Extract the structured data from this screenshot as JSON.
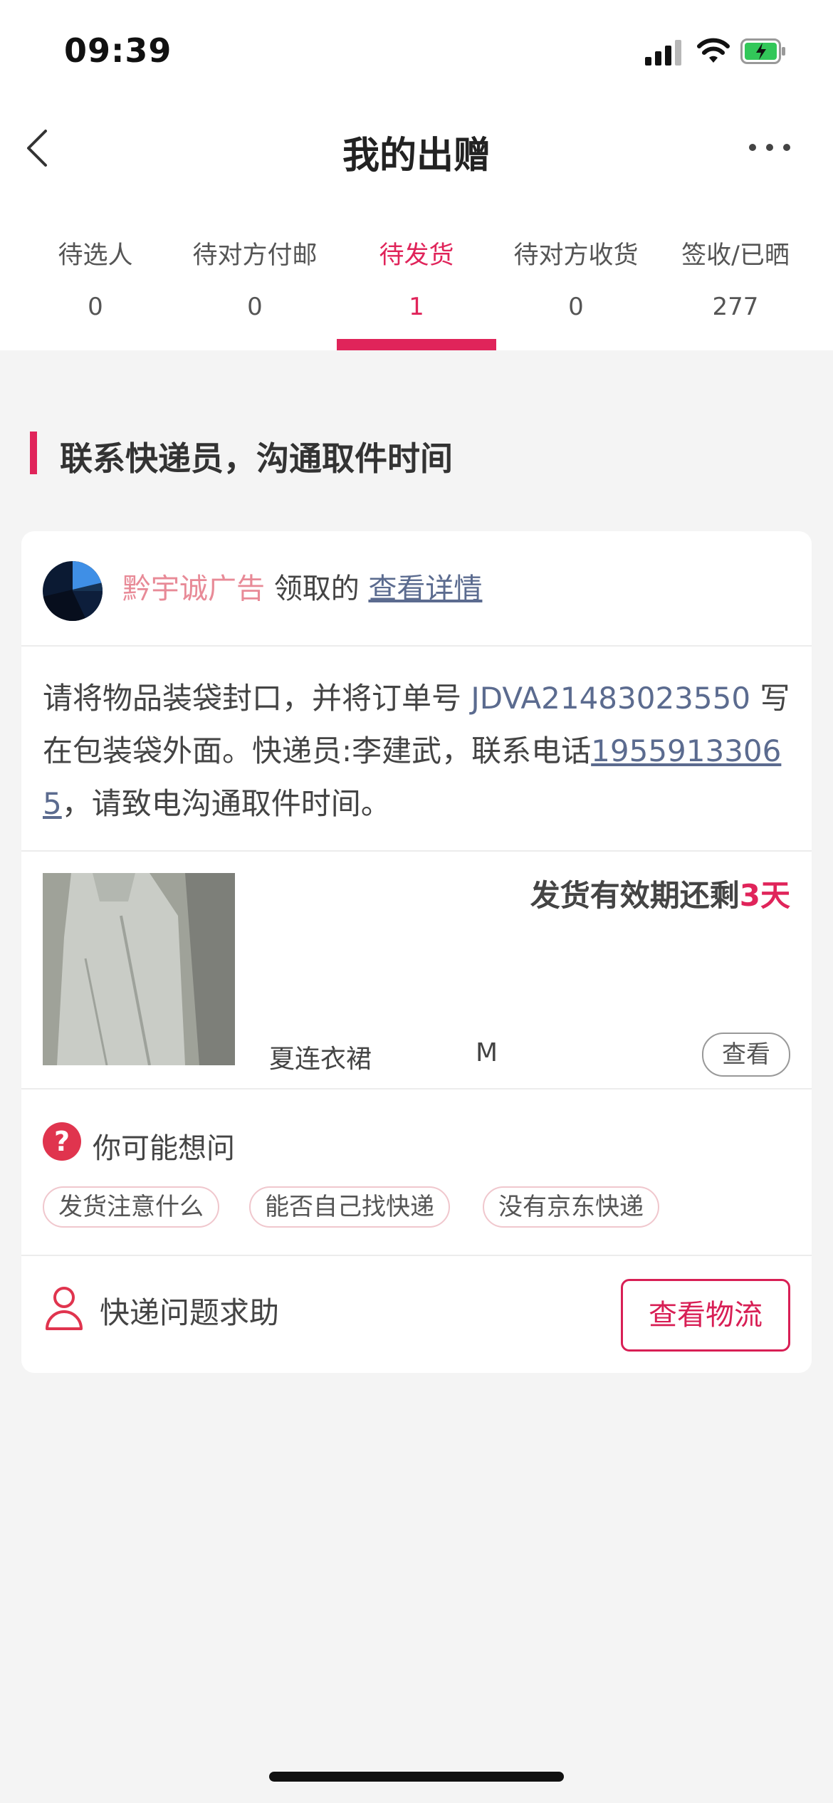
{
  "status_bar": {
    "time": "09:39"
  },
  "header": {
    "title": "我的出赠",
    "back_icon": "chevron-left-icon",
    "more_icon": "more-dots-icon"
  },
  "tabs": [
    {
      "label": "待选人",
      "count": "0",
      "active": false
    },
    {
      "label": "待对方付邮",
      "count": "0",
      "active": false
    },
    {
      "label": "待发货",
      "count": "1",
      "active": true
    },
    {
      "label": "待对方收货",
      "count": "0",
      "active": false
    },
    {
      "label": "签收/已晒",
      "count": "277",
      "active": false
    }
  ],
  "section": {
    "title": "联系快递员，沟通取件时间"
  },
  "card": {
    "claimer_name": "黔宇诚广告",
    "claim_text": "领取的",
    "detail_link": "查看详情",
    "instruction_prefix": "请将物品装袋封口，并将订单号 ",
    "order_number": "JDVA21483023550",
    "instruction_mid": " 写在包装袋外面。快递员:李建武，联系电话",
    "phone": "19559133065",
    "instruction_suffix": "，请致电沟通取件时间。",
    "deadline_prefix": "发货有效期还剩",
    "deadline_days": "3天",
    "item_name": "夏连衣裙",
    "item_size": "M",
    "view_button": "查看",
    "faq_title": "你可能想问",
    "faq_chips": [
      "发货注意什么",
      "能否自己找快递",
      "没有京东快递"
    ],
    "help_text": "快递问题求助",
    "track_button": "查看物流"
  },
  "colors": {
    "accent": "#e0245a",
    "link": "#5b6b8f",
    "claimer": "#e88a97"
  }
}
